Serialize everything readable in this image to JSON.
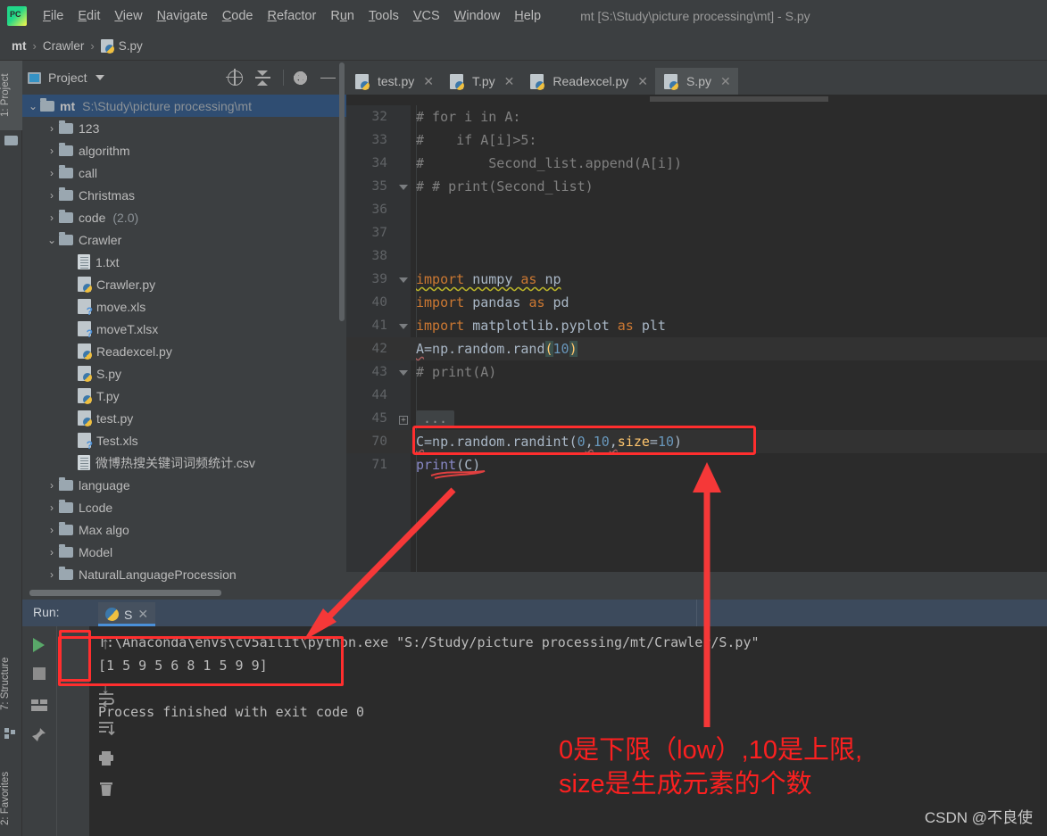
{
  "window": {
    "title": "mt [S:\\Study\\picture processing\\mt] - S.py",
    "app_icon": "pycharm-logo-icon"
  },
  "menu": {
    "items": [
      {
        "label": "File"
      },
      {
        "label": "Edit"
      },
      {
        "label": "View"
      },
      {
        "label": "Navigate"
      },
      {
        "label": "Code"
      },
      {
        "label": "Refactor"
      },
      {
        "label": "Run"
      },
      {
        "label": "Tools"
      },
      {
        "label": "VCS"
      },
      {
        "label": "Window"
      },
      {
        "label": "Help"
      }
    ]
  },
  "breadcrumb": {
    "items": [
      "mt",
      "Crawler",
      "S.py"
    ],
    "separator": "›"
  },
  "left_strip": {
    "project_tab": "1: Project",
    "structure_tab": "7: Structure",
    "favorites_tab": "2: Favorites"
  },
  "project_panel": {
    "title": "Project",
    "actions": [
      "locate-icon",
      "collapse-all-icon",
      "settings-icon",
      "hide-icon"
    ],
    "tree": [
      {
        "indent": 0,
        "arrow": "⌄",
        "icon": "folder-icon",
        "name": "mt",
        "sub": "S:\\Study\\picture processing\\mt",
        "selected": true,
        "bold": true
      },
      {
        "indent": 1,
        "arrow": "›",
        "icon": "folder-icon",
        "name": "123",
        "sub": ""
      },
      {
        "indent": 1,
        "arrow": "›",
        "icon": "folder-icon",
        "name": "algorithm",
        "sub": ""
      },
      {
        "indent": 1,
        "arrow": "›",
        "icon": "folder-icon",
        "name": "call",
        "sub": ""
      },
      {
        "indent": 1,
        "arrow": "›",
        "icon": "folder-icon",
        "name": "Christmas",
        "sub": ""
      },
      {
        "indent": 1,
        "arrow": "›",
        "icon": "folder-icon",
        "name": "code",
        "sub": "(2.0)"
      },
      {
        "indent": 1,
        "arrow": "⌄",
        "icon": "folder-icon",
        "name": "Crawler",
        "sub": ""
      },
      {
        "indent": 2,
        "arrow": "",
        "icon": "text-file-icon",
        "name": "1.txt",
        "sub": ""
      },
      {
        "indent": 2,
        "arrow": "",
        "icon": "python-file-icon",
        "name": "Crawler.py",
        "sub": ""
      },
      {
        "indent": 2,
        "arrow": "",
        "icon": "excel-file-icon",
        "name": "move.xls",
        "sub": ""
      },
      {
        "indent": 2,
        "arrow": "",
        "icon": "excel-file-icon",
        "name": "moveT.xlsx",
        "sub": ""
      },
      {
        "indent": 2,
        "arrow": "",
        "icon": "python-file-icon",
        "name": "Readexcel.py",
        "sub": ""
      },
      {
        "indent": 2,
        "arrow": "",
        "icon": "python-file-icon",
        "name": "S.py",
        "sub": ""
      },
      {
        "indent": 2,
        "arrow": "",
        "icon": "python-file-icon",
        "name": "T.py",
        "sub": ""
      },
      {
        "indent": 2,
        "arrow": "",
        "icon": "python-file-icon",
        "name": "test.py",
        "sub": ""
      },
      {
        "indent": 2,
        "arrow": "",
        "icon": "excel-file-icon",
        "name": "Test.xls",
        "sub": ""
      },
      {
        "indent": 2,
        "arrow": "",
        "icon": "text-file-icon",
        "name": "微博热搜关键词词频统计.csv",
        "sub": ""
      },
      {
        "indent": 1,
        "arrow": "›",
        "icon": "folder-icon",
        "name": "language",
        "sub": ""
      },
      {
        "indent": 1,
        "arrow": "›",
        "icon": "folder-icon",
        "name": "Lcode",
        "sub": ""
      },
      {
        "indent": 1,
        "arrow": "›",
        "icon": "folder-icon",
        "name": "Max algo",
        "sub": ""
      },
      {
        "indent": 1,
        "arrow": "›",
        "icon": "folder-icon",
        "name": "Model",
        "sub": ""
      },
      {
        "indent": 1,
        "arrow": "›",
        "icon": "folder-icon",
        "name": "NaturalLanguageProcession",
        "sub": ""
      }
    ]
  },
  "editor_tabs": [
    {
      "label": "test.py",
      "active": false
    },
    {
      "label": "T.py",
      "active": false
    },
    {
      "label": "Readexcel.py",
      "active": false
    },
    {
      "label": "S.py",
      "active": true
    }
  ],
  "code": {
    "lines": [
      {
        "no": "32",
        "fold": "",
        "text": "# for i in A:",
        "style": "comment"
      },
      {
        "no": "33",
        "fold": "",
        "text": "#    if A[i]>5:",
        "style": "comment"
      },
      {
        "no": "34",
        "fold": "",
        "text": "#        Second_list.append(A[i])",
        "style": "comment"
      },
      {
        "no": "35",
        "fold": "collapse",
        "text": "# # print(Second_list)",
        "style": "comment"
      },
      {
        "no": "36",
        "fold": "",
        "text": "",
        "style": "plain"
      },
      {
        "no": "37",
        "fold": "",
        "text": "",
        "style": "plain"
      },
      {
        "no": "38",
        "fold": "",
        "text": "",
        "style": "plain"
      },
      {
        "no": "39",
        "fold": "collapse",
        "text": "import numpy as np",
        "style": "import-warn"
      },
      {
        "no": "40",
        "fold": "",
        "text": "import pandas as pd",
        "style": "import"
      },
      {
        "no": "41",
        "fold": "collapse",
        "text": "import matplotlib.pyplot as plt",
        "style": "import"
      },
      {
        "no": "42",
        "fold": "",
        "text": "A=np.random.rand(10)",
        "style": "code-hl"
      },
      {
        "no": "43",
        "fold": "collapse",
        "text": "# print(A)",
        "style": "comment"
      },
      {
        "no": "44",
        "fold": "",
        "text": "",
        "style": "plain"
      },
      {
        "no": "45",
        "fold": "expand",
        "text": "...",
        "style": "folded"
      },
      {
        "no": "70",
        "fold": "",
        "text": "C=np.random.randint(0,10,size=10)",
        "style": "randint"
      },
      {
        "no": "71",
        "fold": "",
        "text": "print(C)",
        "style": "printc"
      }
    ]
  },
  "run_panel": {
    "label": "Run:",
    "tab_name": "S",
    "toolbar_left": [
      "run-icon",
      "stop-icon",
      "layout-icon",
      "pin-icon"
    ],
    "toolbar_right": [
      "scroll-up-icon",
      "scroll-down-icon",
      "soft-wrap-icon",
      "scroll-to-end-icon",
      "print-icon",
      "clear-all-icon"
    ],
    "console_lines": [
      "T:\\Anaconda\\envs\\cv5ailit\\python.exe \"S:/Study/picture processing/mt/Crawler/S.py\"",
      "[1 5 9 5 6 8 1 5 9 9]",
      "",
      "Process finished with exit code 0"
    ]
  },
  "annotations": {
    "note_line1": "0是下限（low）,10是上限,",
    "note_line2": "size是生成元素的个数",
    "watermark": "CSDN @不良使",
    "accent_color": "#ff2e2e"
  }
}
